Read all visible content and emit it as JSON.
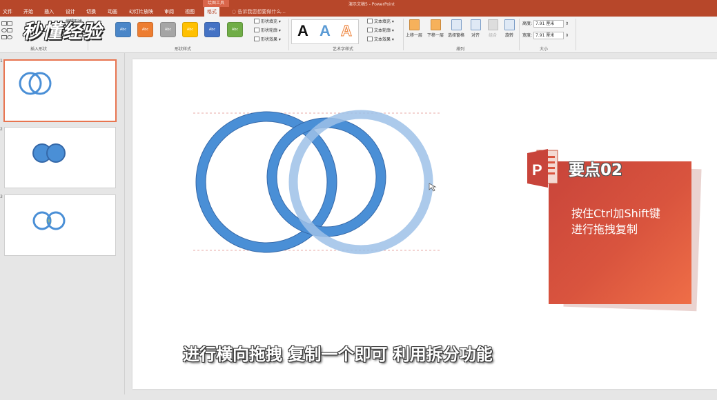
{
  "window": {
    "title": "演示文稿5 - PowerPoint",
    "context_tab_label": "绘图工具"
  },
  "tabs": [
    {
      "label": "文件"
    },
    {
      "label": "开始"
    },
    {
      "label": "插入"
    },
    {
      "label": "设计"
    },
    {
      "label": "切换"
    },
    {
      "label": "动画"
    },
    {
      "label": "幻灯片放映"
    },
    {
      "label": "审阅"
    },
    {
      "label": "视图"
    },
    {
      "label": "格式",
      "active": true
    }
  ],
  "tell_me": {
    "placeholder": "告诉我您想要做什么..."
  },
  "ribbon": {
    "insert_shapes": {
      "label": "插入形状",
      "edit_shape": "编辑形状"
    },
    "shape_styles": {
      "label": "形状样式",
      "swatch_text": "Abc",
      "swatches": [
        "#4a86c8",
        "#ed7d31",
        "#a5a5a5",
        "#ffc000",
        "#4472c4",
        "#70ad47"
      ],
      "fill": "形状填充",
      "outline": "形状轮廓",
      "effects": "形状效果"
    },
    "wordart": {
      "label": "艺术字样式",
      "sample": "A",
      "text_fill": "文本填充",
      "text_outline": "文本轮廓",
      "text_effects": "文本效果"
    },
    "arrange": {
      "label": "排列",
      "bring_forward": "上移一层",
      "send_backward": "下移一层",
      "selection_pane": "选择窗格",
      "align": "对齐",
      "group": "组合",
      "rotate": "旋转"
    },
    "size": {
      "label": "大小",
      "height_label": "高度:",
      "height_value": "7.91 厘米",
      "width_label": "宽度:",
      "width_value": "7.91 厘米"
    }
  },
  "logo": {
    "text": "秒懂经验"
  },
  "slides": [
    {
      "number": "1",
      "active": true
    },
    {
      "number": "2"
    },
    {
      "number": "3"
    }
  ],
  "subtitle": "进行横向拖拽 复制一个即可 利用拆分功能",
  "key_point": {
    "title": "要点02",
    "body_line1": "按住Ctrl加Shift键",
    "body_line2": "进行拖拽复制"
  },
  "colors": {
    "accent": "#b7472a",
    "ring": "#4a8fd6",
    "ring_stroke": "#3568a8",
    "ring_ghost": "#9dc1e8",
    "card": "#d9543e",
    "highlight": "#f6ea2e"
  }
}
